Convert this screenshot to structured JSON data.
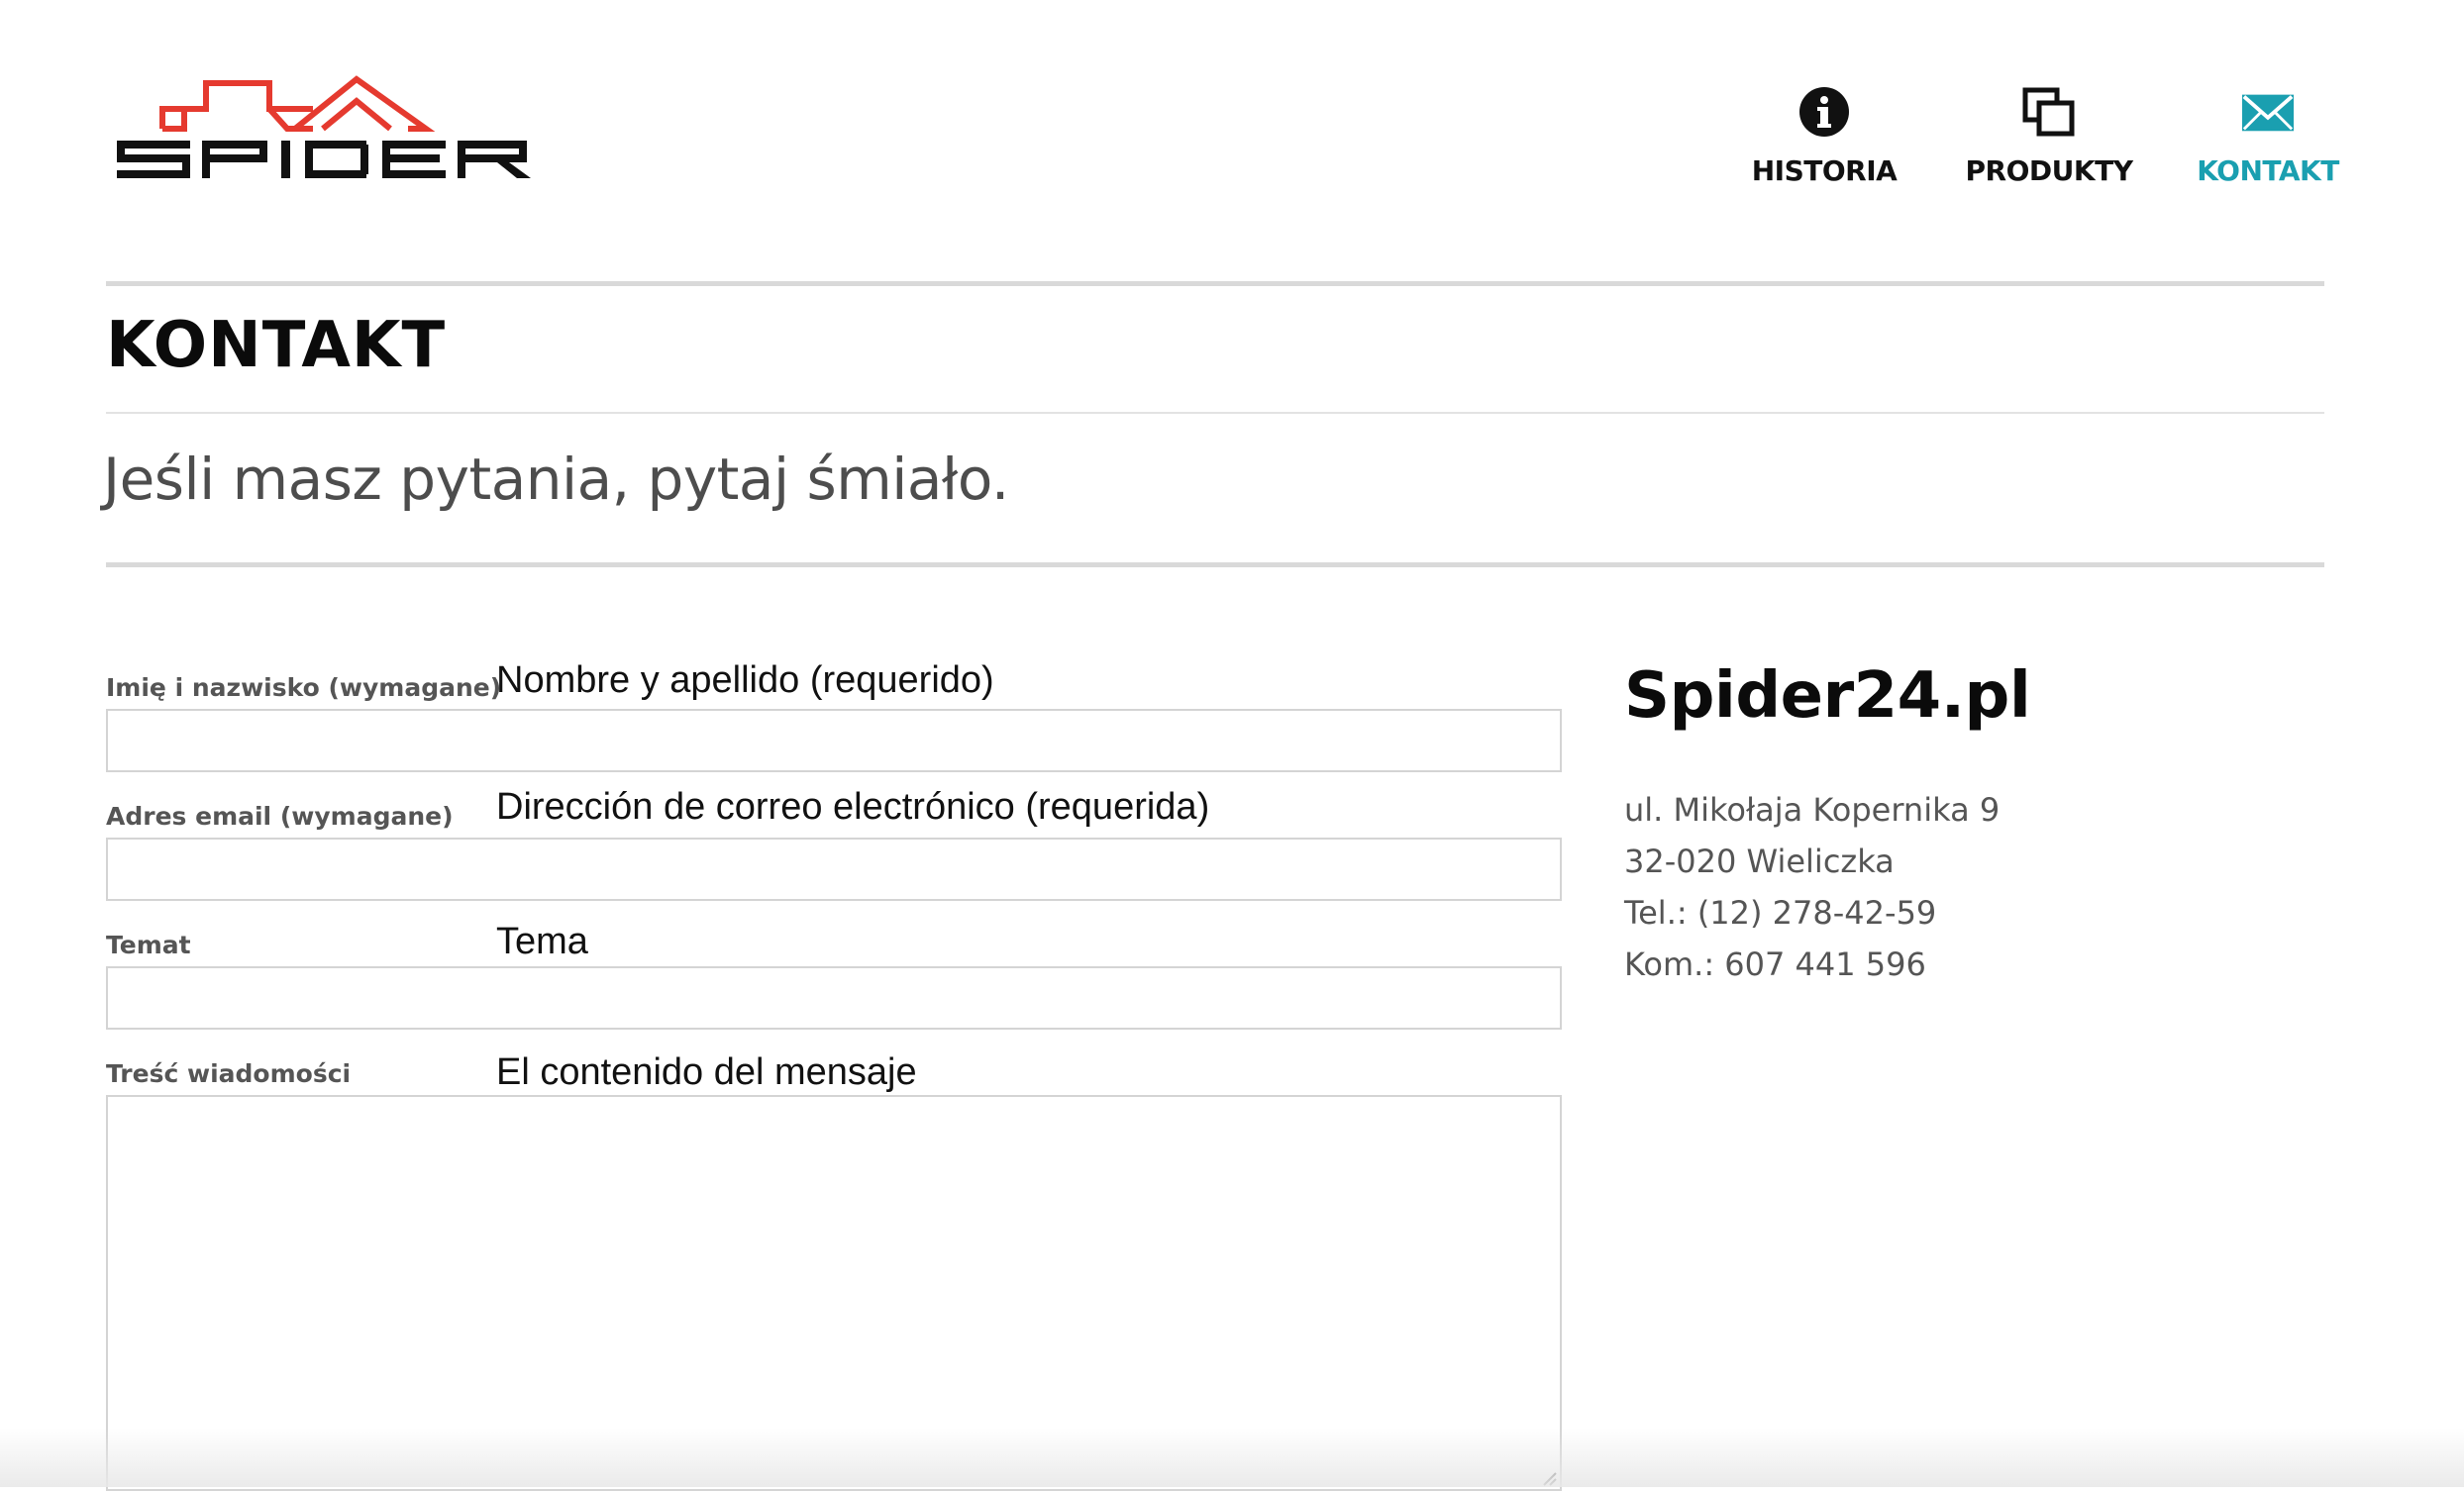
{
  "header": {
    "logo": {
      "text": "SPIDER",
      "colors": {
        "roof": "#e53a2f",
        "text": "#111111"
      }
    },
    "nav": [
      {
        "label": "HISTORIA",
        "icon": "info-icon",
        "active": false
      },
      {
        "label": "PRODUKTY",
        "icon": "copy-windows-icon",
        "active": false
      },
      {
        "label": "KONTAKT",
        "icon": "envelope-icon",
        "active": true
      }
    ],
    "accent_color": "#1a9fb0"
  },
  "page": {
    "title": "KONTAKT",
    "subtitle": "Jeśli masz pytania, pytaj śmiało."
  },
  "form": {
    "fields": [
      {
        "label": "Imię i nazwisko (wymagane)",
        "translation": "Nombre y apellido (requerido)",
        "value": ""
      },
      {
        "label": "Adres email (wymagane)",
        "translation": "Dirección de correo electrónico (requerida)",
        "value": ""
      },
      {
        "label": "Temat",
        "translation": "Tema",
        "value": ""
      },
      {
        "label": "Treść wiadomości",
        "translation": "El contenido del mensaje",
        "value": ""
      }
    ]
  },
  "contact": {
    "name": "Spider24.pl",
    "lines": [
      "ul. Mikołaja Kopernika 9",
      "32-020 Wieliczka",
      "Tel.: (12) 278-42-59",
      "Kom.: 607 441 596"
    ]
  }
}
